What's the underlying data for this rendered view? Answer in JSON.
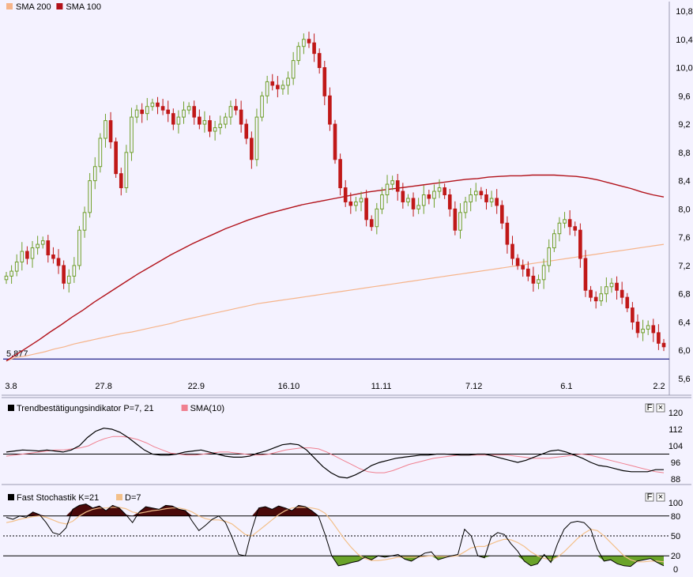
{
  "colors": {
    "background": "#f4f2ff",
    "up_candle": "#6f9f2a",
    "down_candle": "#c01818",
    "sma200": "#f6b48a",
    "sma100": "#b2121a",
    "support_line": "#20208a",
    "trend_line": "#000000",
    "trend_sma": "#f08090",
    "stoch_k": "#000000",
    "stoch_d": "#f3c08a",
    "stoch_over": "#4a0a0a",
    "stoch_under": "#6aa32a"
  },
  "main": {
    "legend": [
      {
        "label": "SMA 200",
        "color": "#f6b48a"
      },
      {
        "label": "SMA 100",
        "color": "#b2121a"
      }
    ],
    "support_label": "5,877"
  },
  "trend_panel": {
    "legend": [
      {
        "label": "Trendbestätigungsindikator P=7, 21",
        "color": "#000000"
      },
      {
        "label": "SMA(10)",
        "color": "#f08090"
      }
    ],
    "button_labels": [
      "F",
      "×"
    ]
  },
  "stoch_panel": {
    "legend": [
      {
        "label": "Fast Stochastik K=21",
        "color": "#000000"
      },
      {
        "label": "D=7",
        "color": "#f3c08a"
      }
    ],
    "button_labels": [
      "F",
      "×"
    ]
  },
  "chart_data": [
    {
      "type": "candlestick",
      "title": "",
      "x_ticks": [
        "3.8",
        "27.8",
        "22.9",
        "16.10",
        "11.11",
        "7.12",
        "6.1",
        "2.2"
      ],
      "y_ticks": [
        "10,8",
        "10,4",
        "10,0",
        "9,6",
        "9,2",
        "8,8",
        "8,4",
        "8,0",
        "7,6",
        "7,2",
        "6,8",
        "6,4",
        "6,0",
        "5,6"
      ],
      "ylim": [
        5.6,
        10.8
      ],
      "grid": false,
      "support_level": 5.877,
      "closes": [
        7.05,
        7.12,
        7.25,
        7.4,
        7.3,
        7.45,
        7.5,
        7.55,
        7.35,
        7.3,
        7.2,
        6.95,
        7.05,
        7.2,
        7.7,
        7.95,
        8.4,
        8.6,
        9.0,
        9.25,
        8.95,
        8.5,
        8.3,
        8.8,
        9.3,
        9.4,
        9.35,
        9.45,
        9.5,
        9.45,
        9.4,
        9.35,
        9.2,
        9.3,
        9.4,
        9.45,
        9.3,
        9.2,
        9.25,
        9.1,
        9.15,
        9.2,
        9.3,
        9.45,
        9.4,
        9.2,
        9.0,
        8.7,
        9.3,
        9.6,
        9.8,
        9.75,
        9.7,
        9.75,
        9.85,
        10.1,
        10.3,
        10.4,
        10.35,
        10.2,
        10.0,
        9.6,
        9.2,
        8.7,
        8.3,
        8.1,
        8.05,
        8.1,
        8.15,
        7.85,
        7.75,
        8.0,
        8.2,
        8.35,
        8.4,
        8.25,
        8.1,
        8.15,
        8.0,
        8.05,
        8.2,
        8.15,
        8.25,
        8.3,
        8.2,
        8.0,
        7.7,
        7.95,
        8.1,
        8.2,
        8.25,
        8.2,
        8.1,
        8.15,
        8.05,
        7.8,
        7.5,
        7.3,
        7.2,
        7.15,
        7.05,
        6.95,
        7.0,
        7.2,
        7.45,
        7.65,
        7.8,
        7.85,
        7.75,
        7.7,
        7.3,
        6.85,
        6.75,
        6.7,
        6.8,
        6.9,
        6.95,
        6.85,
        6.75,
        6.6,
        6.4,
        6.25,
        6.3,
        6.35,
        6.25,
        6.1,
        6.05
      ],
      "series": [
        {
          "name": "SMA 200",
          "values": [
            5.85,
            5.9,
            5.92,
            5.95,
            5.98,
            6.02,
            6.05,
            6.09,
            6.12,
            6.15,
            6.18,
            6.21,
            6.24,
            6.26,
            6.29,
            6.32,
            6.35,
            6.38,
            6.42,
            6.45,
            6.48,
            6.51,
            6.54,
            6.57,
            6.6,
            6.63,
            6.66,
            6.68,
            6.7,
            6.72,
            6.74,
            6.76,
            6.78,
            6.8,
            6.82,
            6.84,
            6.86,
            6.88,
            6.9,
            6.92,
            6.94,
            6.96,
            6.98,
            7.0,
            7.02,
            7.04,
            7.06,
            7.08,
            7.1,
            7.12,
            7.14,
            7.16,
            7.18,
            7.2,
            7.22,
            7.24,
            7.26,
            7.28,
            7.3,
            7.32,
            7.34,
            7.36,
            7.38,
            7.4,
            7.42,
            7.44,
            7.46,
            7.48,
            7.5
          ]
        },
        {
          "name": "SMA 100",
          "values": [
            5.85,
            5.95,
            6.05,
            6.15,
            6.26,
            6.36,
            6.47,
            6.57,
            6.68,
            6.78,
            6.88,
            6.98,
            7.08,
            7.17,
            7.26,
            7.35,
            7.43,
            7.51,
            7.58,
            7.65,
            7.72,
            7.78,
            7.84,
            7.89,
            7.94,
            7.98,
            8.02,
            8.06,
            8.09,
            8.12,
            8.15,
            8.18,
            8.21,
            8.24,
            8.26,
            8.28,
            8.3,
            8.32,
            8.34,
            8.36,
            8.38,
            8.4,
            8.42,
            8.43,
            8.45,
            8.46,
            8.47,
            8.47,
            8.48,
            8.48,
            8.48,
            8.47,
            8.46,
            8.44,
            8.41,
            8.37,
            8.33,
            8.29,
            8.24,
            8.2,
            8.17
          ]
        }
      ]
    },
    {
      "type": "line",
      "title": "Trendbestätigungsindikator P=7, 21",
      "y_ticks": [
        "120",
        "112",
        "104",
        "96",
        "88"
      ],
      "ylim": [
        88,
        120
      ],
      "reference_line": 100,
      "series": [
        {
          "name": "Trendbestätigungsindikator P=7, 21",
          "values": [
            101,
            101.5,
            102,
            101.8,
            101.5,
            102,
            101.5,
            101,
            102,
            104,
            108,
            111,
            112.5,
            112,
            110.5,
            108,
            105,
            102,
            100,
            99.5,
            99.5,
            100,
            101,
            101.5,
            102,
            101,
            100,
            99,
            98.5,
            98.5,
            99,
            100.5,
            101.5,
            103,
            104.5,
            105,
            104.5,
            102,
            98,
            94,
            91,
            89,
            88.5,
            90,
            92,
            94.5,
            96,
            97,
            98,
            98.5,
            99,
            99.5,
            99.5,
            100,
            100,
            99.8,
            99.5,
            99.5,
            100,
            100,
            99,
            98,
            97,
            96,
            97,
            98.5,
            100,
            101.5,
            102,
            101,
            99.5,
            98,
            96,
            94.5,
            94,
            93,
            92,
            91.5,
            91.5,
            91.5,
            92.5,
            92.5
          ]
        },
        {
          "name": "SMA(10)",
          "values": [
            99,
            99.5,
            100,
            100.5,
            101,
            101.5,
            102,
            102,
            102.5,
            103,
            104,
            106,
            107.5,
            108.5,
            108.5,
            108,
            107,
            105.5,
            103.5,
            102,
            100.5,
            100,
            99.5,
            99.5,
            100,
            100.5,
            101,
            101,
            100.5,
            100,
            99.5,
            99.5,
            100,
            101,
            102,
            102.5,
            103,
            103,
            102.5,
            101,
            99,
            97,
            95,
            93,
            91.5,
            91,
            91,
            92,
            93.5,
            95,
            96,
            97,
            98,
            98.5,
            99,
            99.5,
            99.5,
            99.5,
            99.5,
            99.5,
            99.5,
            99.5,
            99,
            98.5,
            98,
            98,
            98,
            98.5,
            99,
            99.5,
            100,
            99.5,
            98.5,
            97.5,
            96.5,
            95.5,
            94.5,
            93.5,
            92.5,
            91.5,
            91
          ]
        }
      ]
    },
    {
      "type": "area",
      "title": "Fast Stochastik K=21",
      "y_ticks": [
        "100",
        "80",
        "50",
        "20",
        "0"
      ],
      "ylim": [
        0,
        100
      ],
      "levels": [
        80,
        50,
        20
      ],
      "series": [
        {
          "name": "Fast Stochastik K=21",
          "values": [
            78,
            75,
            80,
            78,
            86,
            82,
            70,
            55,
            52,
            62,
            90,
            96,
            98,
            92,
            95,
            88,
            96,
            92,
            82,
            70,
            86,
            94,
            92,
            90,
            96,
            95,
            90,
            88,
            72,
            58,
            66,
            75,
            80,
            70,
            48,
            22,
            20,
            60,
            92,
            94,
            90,
            95,
            92,
            88,
            96,
            94,
            88,
            80,
            52,
            20,
            5,
            7,
            10,
            12,
            18,
            14,
            20,
            18,
            20,
            22,
            15,
            12,
            18,
            24,
            26,
            14,
            17,
            20,
            22,
            60,
            50,
            20,
            17,
            48,
            55,
            52,
            38,
            27,
            12,
            5,
            8,
            22,
            10,
            38,
            60,
            70,
            72,
            70,
            60,
            30,
            12,
            14,
            8,
            5,
            4,
            12,
            14,
            16,
            10,
            5
          ]
        },
        {
          "name": "D=7",
          "values": [
            70,
            72,
            75,
            77,
            79,
            80,
            78,
            74,
            70,
            68,
            72,
            80,
            86,
            90,
            92,
            92,
            93,
            93,
            91,
            86,
            84,
            86,
            88,
            89,
            91,
            92,
            92,
            90,
            86,
            80,
            76,
            74,
            74,
            72,
            68,
            60,
            52,
            50,
            58,
            66,
            74,
            82,
            88,
            92,
            93,
            93,
            92,
            90,
            84,
            72,
            58,
            44,
            32,
            22,
            16,
            13,
            13,
            14,
            16,
            18,
            18,
            18,
            18,
            19,
            20,
            19,
            19,
            19,
            20,
            26,
            32,
            34,
            34,
            38,
            42,
            45,
            44,
            40,
            34,
            26,
            20,
            16,
            14,
            18,
            26,
            36,
            46,
            54,
            60,
            58,
            50,
            40,
            30,
            20,
            14,
            11,
            11,
            12,
            12,
            11
          ]
        }
      ]
    }
  ]
}
